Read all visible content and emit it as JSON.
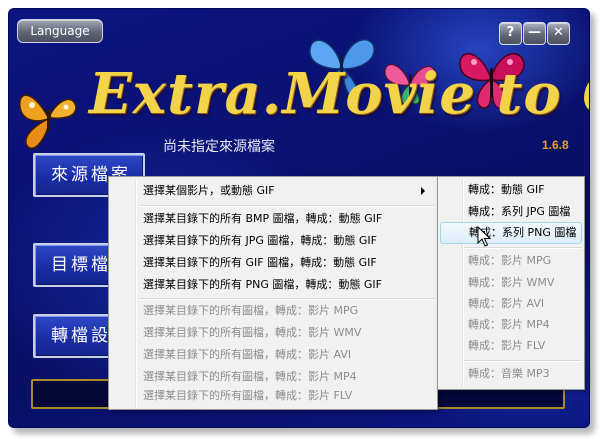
{
  "window": {
    "language_label": "Language",
    "help_label": "?",
    "minimize_label": "—",
    "close_label": "✕",
    "title": "Extra.Movie to Gif",
    "version": "1.6.8"
  },
  "side_buttons": {
    "source": "來源檔案",
    "target": "目標檔案",
    "convert": "轉檔設定"
  },
  "hint": "尚未指定來源檔案",
  "main_menu": {
    "items": [
      {
        "label": "選擇某個影片，或動態 GIF"
      },
      {
        "label": "選擇某目錄下的所有 BMP 圖檔，轉成：動態 GIF"
      },
      {
        "label": "選擇某目錄下的所有 JPG 圖檔，轉成：動態 GIF"
      },
      {
        "label": "選擇某目錄下的所有 GIF 圖檔，轉成：動態 GIF"
      },
      {
        "label": "選擇某目錄下的所有 PNG 圖檔，轉成：動態 GIF"
      },
      {
        "label": "選擇某目錄下的所有圖檔，轉成：影片 MPG"
      },
      {
        "label": "選擇某目錄下的所有圖檔，轉成：影片 WMV"
      },
      {
        "label": "選擇某目錄下的所有圖檔，轉成：影片 AVI"
      },
      {
        "label": "選擇某目錄下的所有圖檔，轉成：影片 MP4"
      },
      {
        "label": "選擇某目錄下的所有圖檔，轉成：影片 FLV"
      }
    ]
  },
  "sub_menu": {
    "items": [
      {
        "label": "轉成：動態 GIF"
      },
      {
        "label": "轉成：系列 JPG 圖檔"
      },
      {
        "label": "轉成：系列 PNG 圖檔"
      },
      {
        "label": "轉成：影片 MPG"
      },
      {
        "label": "轉成：影片 WMV"
      },
      {
        "label": "轉成：影片 AVI"
      },
      {
        "label": "轉成：影片 MP4"
      },
      {
        "label": "轉成：影片 FLV"
      },
      {
        "label": "轉成：音樂 MP3"
      }
    ]
  },
  "colors": {
    "background": "#0a1275",
    "title": "#f3d34a",
    "version": "#e8a020",
    "menu_bg": "#f1f1f1",
    "menu_hover": "#dcedf8",
    "disabled_text": "#8d8d8d"
  },
  "icons": {
    "cursor": "arrow-cursor-icon",
    "submenu_arrow": "submenu-arrow-icon"
  }
}
